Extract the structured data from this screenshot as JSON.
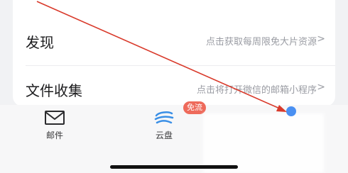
{
  "settings_list": {
    "items": [
      {
        "title": "发现",
        "hint": "点击获取每周限免大片资源",
        "chevron": ">"
      },
      {
        "title": "文件收集",
        "hint": "点击将打开微信的邮箱小程序",
        "chevron": ">"
      }
    ]
  },
  "tabbar": {
    "tabs": [
      {
        "label": "邮件",
        "icon": "mail-icon"
      },
      {
        "label": "云盘",
        "icon": "cloud-drive-icon",
        "badge": "免流"
      }
    ]
  },
  "colors": {
    "accent_blue": "#4a90f2",
    "badge_red": "#ee6a5b",
    "annotation_red": "#d93a2b"
  }
}
